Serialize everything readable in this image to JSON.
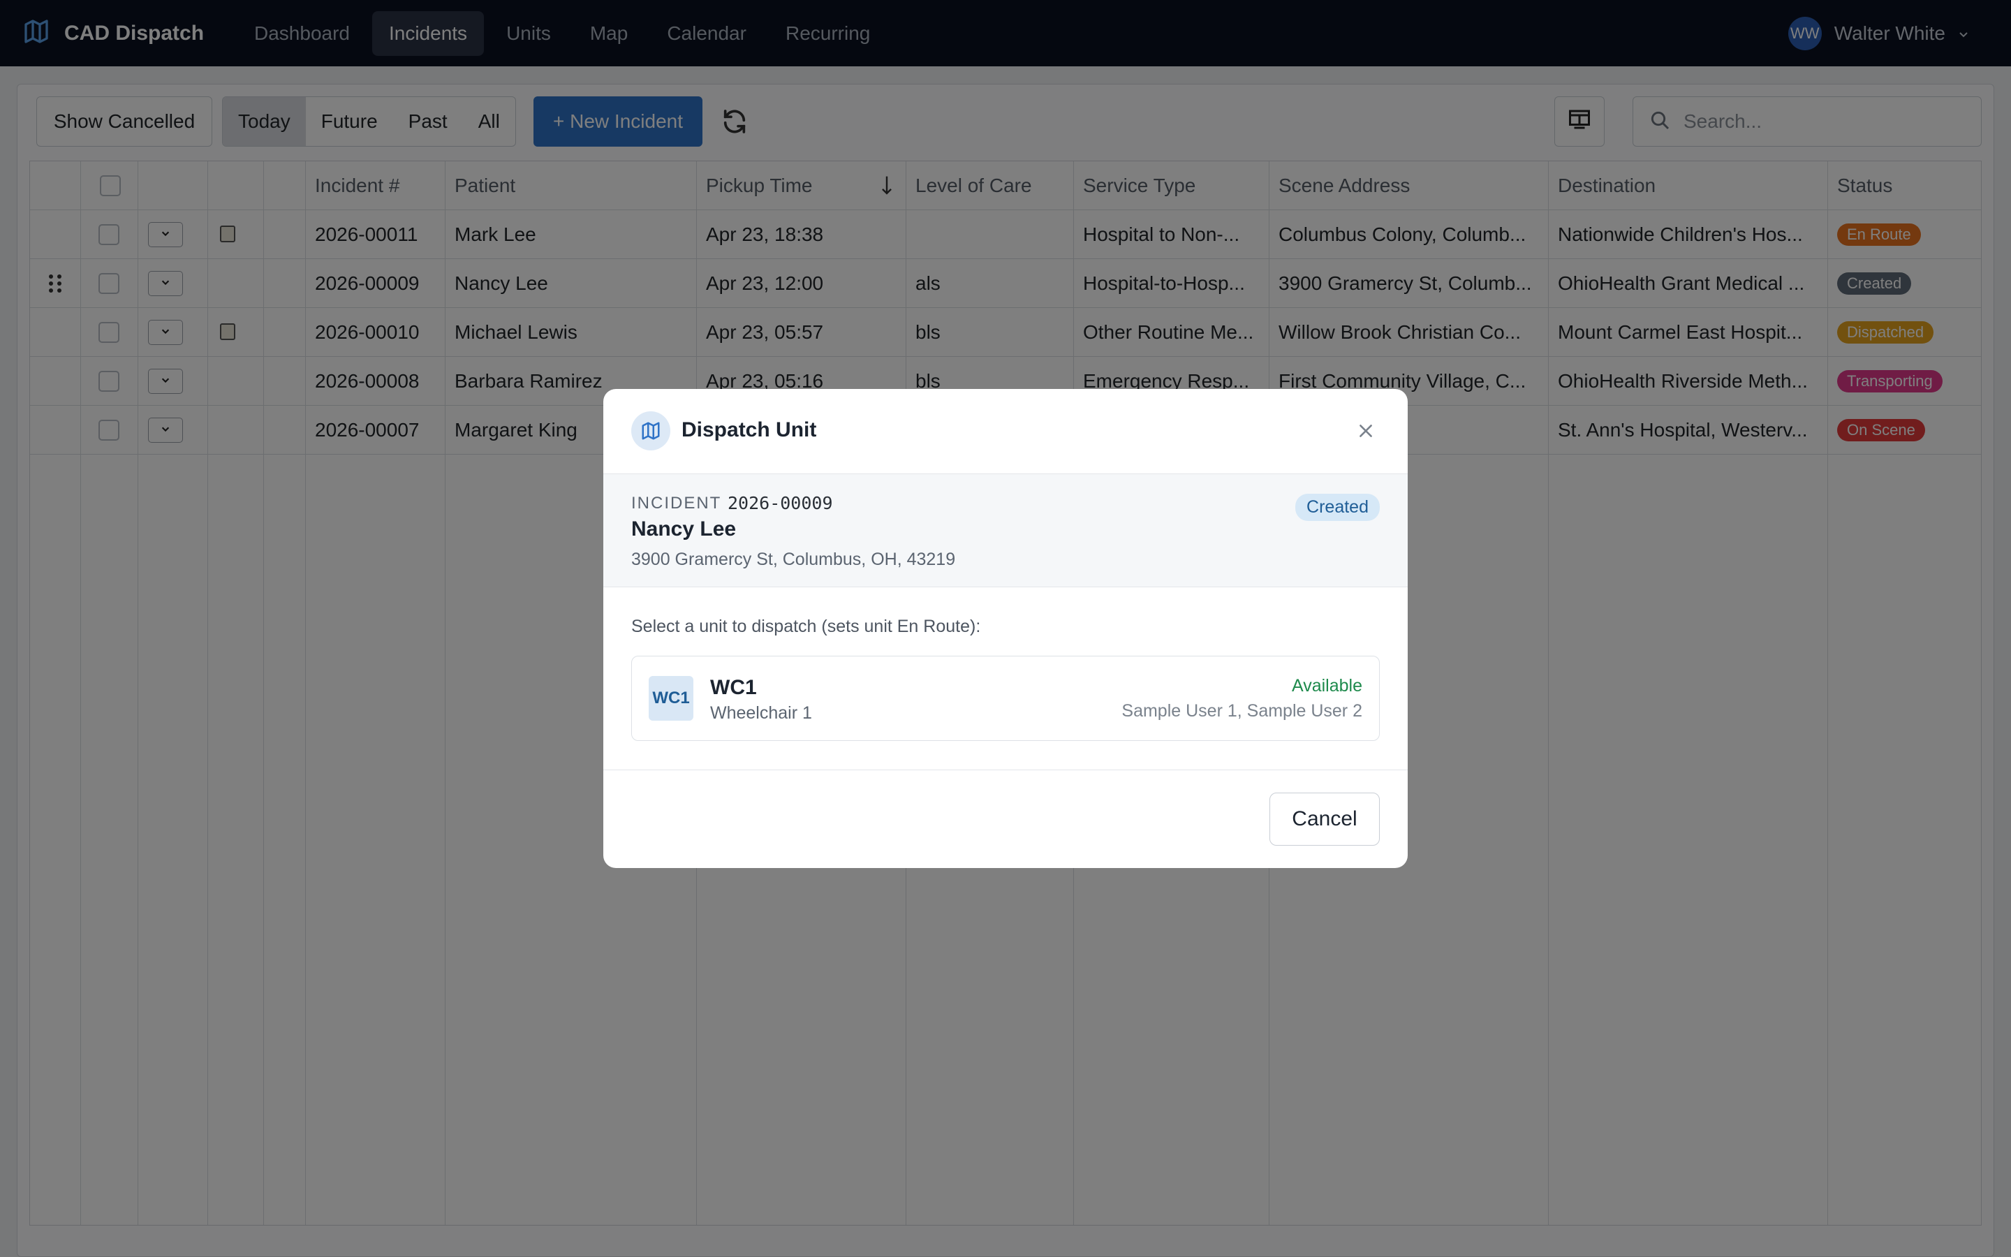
{
  "app": {
    "brand": "CAD Dispatch"
  },
  "nav": {
    "items": [
      "Dashboard",
      "Incidents",
      "Units",
      "Map",
      "Calendar",
      "Recurring"
    ],
    "active": "Incidents"
  },
  "user": {
    "initials": "WW",
    "name": "Walter White"
  },
  "toolbar": {
    "show_cancelled": "Show Cancelled",
    "filters": [
      "Today",
      "Future",
      "Past",
      "All"
    ],
    "active_filter": "Today",
    "new_incident": "+ New Incident",
    "search_placeholder": "Search..."
  },
  "table": {
    "headers": [
      "Incident #",
      "Patient",
      "Pickup Time",
      "Level of Care",
      "Service Type",
      "Scene Address",
      "Destination",
      "Status"
    ],
    "rows": [
      {
        "incident": "2026-00011",
        "patient": "Mark Lee",
        "pickup": "Apr 23, 18:38",
        "level": "",
        "service": "Hospital to Non-...",
        "scene": "Columbus Colony, Columb...",
        "destination": "Nationwide Children's Hos...",
        "status": "En Route",
        "status_color": "#e8731f",
        "calendar": true,
        "drag": false
      },
      {
        "incident": "2026-00009",
        "patient": "Nancy Lee",
        "pickup": "Apr 23, 12:00",
        "level": "als",
        "service": "Hospital-to-Hosp...",
        "scene": "3900 Gramercy St, Columb...",
        "destination": "OhioHealth Grant Medical ...",
        "status": "Created",
        "status_color": "#5f6b78",
        "calendar": false,
        "drag": true
      },
      {
        "incident": "2026-00010",
        "patient": "Michael Lewis",
        "pickup": "Apr 23, 05:57",
        "level": "bls",
        "service": "Other Routine Me...",
        "scene": "Willow Brook Christian Co...",
        "destination": "Mount Carmel East Hospit...",
        "status": "Dispatched",
        "status_color": "#e5a21f",
        "calendar": true,
        "drag": false
      },
      {
        "incident": "2026-00008",
        "patient": "Barbara Ramirez",
        "pickup": "Apr 23, 05:16",
        "level": "bls",
        "service": "Emergency Resp...",
        "scene": "First Community Village, C...",
        "destination": "OhioHealth Riverside Meth...",
        "status": "Transporting",
        "status_color": "#e0398a",
        "calendar": false,
        "drag": false
      },
      {
        "incident": "2026-00007",
        "patient": "Margaret King",
        "pickup": "",
        "level": "",
        "service": "",
        "scene": "vd, Columb...",
        "destination": "St. Ann's Hospital, Westerv...",
        "status": "On Scene",
        "status_color": "#e23a3a",
        "calendar": false,
        "drag": false
      }
    ]
  },
  "modal": {
    "title": "Dispatch Unit",
    "incident_label": "INCIDENT",
    "incident_number": "2026-00009",
    "status": "Created",
    "patient": "Nancy Lee",
    "address": "3900 Gramercy St, Columbus, OH, 43219",
    "prompt": "Select a unit to dispatch (sets unit En Route):",
    "unit": {
      "code": "WC1",
      "name": "WC1",
      "type": "Wheelchair 1",
      "status": "Available",
      "crew": "Sample User 1, Sample User 2"
    },
    "cancel": "Cancel"
  }
}
